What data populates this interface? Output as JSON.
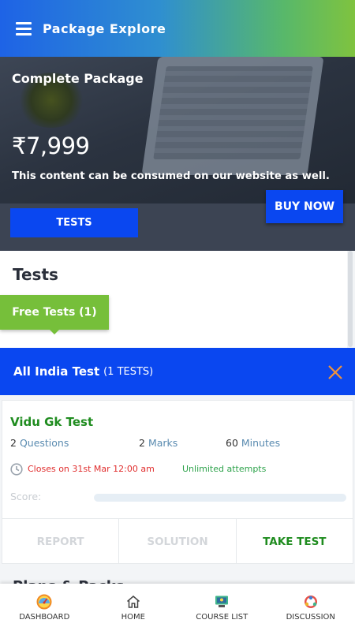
{
  "appbar": {
    "title": "Package Explore"
  },
  "hero": {
    "package_title": "Complete Package",
    "price": "₹7,999",
    "note": "This content can be consumed on our website as well.",
    "buy_label": "BUY NOW",
    "tests_label": "TESTS"
  },
  "section": {
    "title": "Tests",
    "free_tab_label": "Free Tests (1)",
    "peek_title": "Plans & Packs"
  },
  "modal": {
    "title": "All India Test",
    "count": "(1 TESTS)",
    "card": {
      "name": "Vidu Gk Test",
      "questions_value": "2",
      "questions_unit": "Questions",
      "marks_value": "2",
      "marks_unit": "Marks",
      "minutes_value": "60",
      "minutes_unit": "Minutes",
      "closes": "Closes on 31st Mar 12:00 am",
      "attempts": "Unlimited attempts",
      "score_label": "Score:",
      "actions": [
        "REPORT",
        "SOLUTION",
        "TAKE TEST"
      ]
    }
  },
  "bottom_nav": {
    "items": [
      {
        "label": "DASHBOARD",
        "icon": "dashboard-gauge-icon"
      },
      {
        "label": "HOME",
        "icon": "home-icon"
      },
      {
        "label": "COURSE LIST",
        "icon": "course-list-icon"
      },
      {
        "label": "DISCUSSION",
        "icon": "discussion-icon"
      }
    ]
  },
  "colors": {
    "primary_blue": "#0a47f0",
    "green": "#76bf3a",
    "test_green": "#1f8c1f",
    "red": "#e02d2d",
    "close_orange": "#f0923a"
  }
}
